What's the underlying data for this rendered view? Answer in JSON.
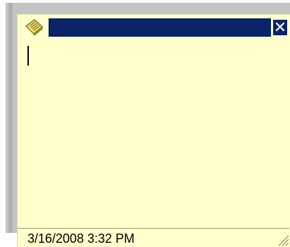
{
  "note": {
    "title": "",
    "body_text": "",
    "timestamp": "3/16/2008 3:32 PM",
    "close_glyph": "✕",
    "icon": "sticky-note-icon",
    "colors": {
      "note_background": "#ffffcc",
      "title_bar": "#0a246a",
      "close_button_glyph": "#ffffff",
      "shadow": "#c4c4c4"
    }
  }
}
